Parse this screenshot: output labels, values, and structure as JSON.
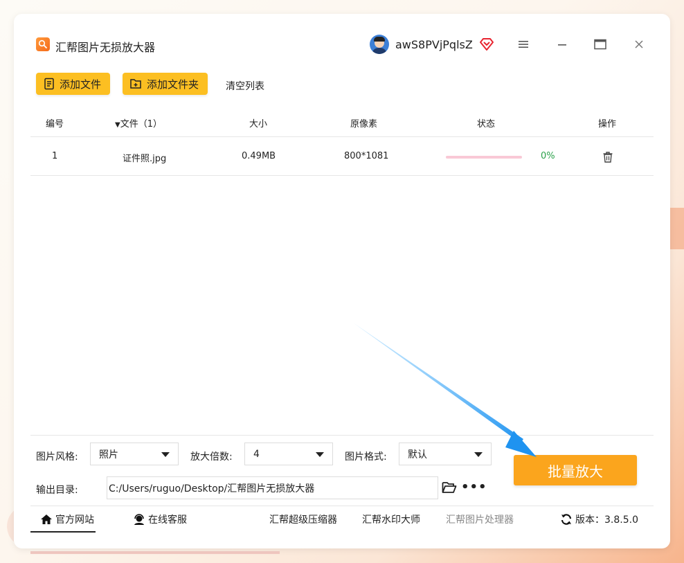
{
  "app": {
    "title": "汇帮图片无损放大器",
    "username": "awS8PVjPqlsZ"
  },
  "toolbar": {
    "add_file": "添加文件",
    "add_folder": "添加文件夹",
    "clear_list": "清空列表"
  },
  "table": {
    "headers": {
      "index": "编号",
      "file": "文件（1）",
      "size": "大小",
      "pixels": "原像素",
      "status": "状态",
      "action": "操作"
    },
    "rows": [
      {
        "index": "1",
        "name": "证件照.jpg",
        "size": "0.49MB",
        "pixels": "800*1081",
        "progress": 0,
        "progress_text": "0%"
      }
    ]
  },
  "settings": {
    "style_label": "图片风格:",
    "style_value": "照片",
    "scale_label": "放大倍数:",
    "scale_value": "4",
    "format_label": "图片格式:",
    "format_value": "默认",
    "output_label": "输出目录:",
    "output_path": "C:/Users/ruguo/Desktop/汇帮图片无损放大器",
    "batch_button": "批量放大"
  },
  "footer": {
    "website": "官方网站",
    "service": "在线客服",
    "compressor": "汇帮超级压缩器",
    "watermark": "汇帮水印大师",
    "processor": "汇帮图片处理器",
    "version": "版本：3.8.5.0"
  },
  "colors": {
    "accent": "#fcbf22",
    "batch": "#fba51d",
    "progress_track": "#f9c9d6",
    "success": "#2aa14a",
    "arrow": "#2b9df2"
  }
}
